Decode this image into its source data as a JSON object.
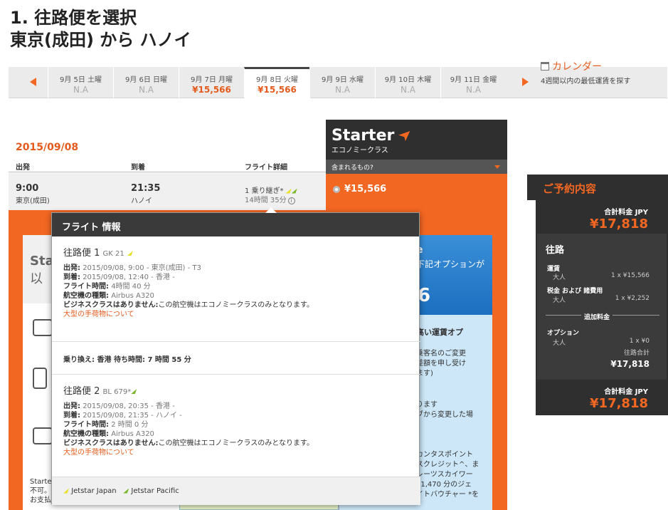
{
  "heading": {
    "line1": "1. 往路便を選択",
    "line2": "東京(成田) から ハノイ"
  },
  "dates": [
    {
      "label": "9月 5日 土曜",
      "price": "N.A",
      "has": false,
      "sel": false
    },
    {
      "label": "9月 6日 日曜",
      "price": "N.A",
      "has": false,
      "sel": false
    },
    {
      "label": "9月 7日 月曜",
      "price": "¥15,566",
      "has": true,
      "sel": false
    },
    {
      "label": "9月 8日 火曜",
      "price": "¥15,566",
      "has": true,
      "sel": true
    },
    {
      "label": "9月 9日 水曜",
      "price": "N.A",
      "has": false,
      "sel": false
    },
    {
      "label": "9月 10日 木曜",
      "price": "N.A",
      "has": false,
      "sel": false
    },
    {
      "label": "9月 11日 金曜",
      "price": "N.A",
      "has": false,
      "sel": false
    }
  ],
  "calendar": {
    "title": "カレンダー",
    "sub": "4週間以内の最低運賃を探す"
  },
  "results": {
    "date": "2015/09/08",
    "col_dep": "出発",
    "col_arr": "到着",
    "col_detail": "フライト詳細",
    "dep_time": "9:00",
    "dep_city": "東京(成田)",
    "arr_time": "21:35",
    "arr_city": "ハノイ",
    "stops": "1 乗り継ぎ*",
    "duration": "14時間 35分"
  },
  "starter": {
    "name": "Starter",
    "sub": "エコノミークラス",
    "bar": "含まれるもの?",
    "price": "¥15,566"
  },
  "leftpanel": {
    "title": "Star",
    "title2": "以",
    "foot1": "Starte",
    "foot2": "不可。",
    "foot3": "お支払いいただきます。搭乗日･時間"
  },
  "bluepanel": {
    "t1": "e",
    "t2": "下記オプションが",
    "big": "6",
    "l1": "高い運賃オプ",
    "l2": "乗客名のご変更",
    "l3": "差額を申し受け",
    "l4": "ます)",
    "l5": "ります",
    "l6": "ブから変更した場",
    "l7": "カンタスポイント",
    "l8": "スクレジット^、ま",
    "l9": "レーツスカイワー",
    "l10": "¥1,470 分のジェ",
    "l11": "イトバウチャー *を"
  },
  "popover": {
    "title": "フライト 情報",
    "seg1": {
      "title": "往路便 1",
      "code": "GK 21",
      "dep_label": "出発:",
      "dep": "2015/09/08, 9:00 - 東京(成田) - T3",
      "arr_label": "到着:",
      "arr": "2015/09/08, 12:40 - 香港 -",
      "dur_label": "フライト時間:",
      "dur": "4時間 40 分",
      "ac_label": "航空機の種類:",
      "ac": "Airbus A320",
      "biz_label": "ビジネスクラスはありません:",
      "biz": "この航空機はエコノミークラスのみとなります。",
      "link": "大型の手荷物について"
    },
    "transfer": "乗り換え: 香港 待ち時間: 7 時間 55 分",
    "seg2": {
      "title": "往路便 2",
      "code": "BL 679*",
      "dep_label": "出発:",
      "dep": "2015/09/08, 20:35 - 香港 -",
      "arr_label": "到着:",
      "arr": "2015/09/08, 21:35 - ハノイ -",
      "dur_label": "フライト時間:",
      "dur": "2 時間 0 分",
      "ac_label": "航空機の種類:",
      "ac": "Airbus A320",
      "biz_label": "ビジネスクラスはありません:",
      "biz": "この航空機はエコノミークラスのみとなります。",
      "link": "大型の手荷物について"
    },
    "legend1": "Jetstar Japan",
    "legend2": "Jetstar Pacific"
  },
  "summary": {
    "tab": "ご予約内容",
    "total_label": "合計料金 JPY",
    "total": "¥17,818",
    "route": "往路",
    "fare_label": "運賃",
    "fare_pax": "大人",
    "fare_val": "1 x ¥15,566",
    "tax_label": "税金 および 諸費用",
    "tax_pax": "大人",
    "tax_val": "1 x ¥2,252",
    "extra_label": "追加料金",
    "opt_label": "オプション",
    "opt_pax": "大人",
    "opt_val": "1 x ¥0",
    "route_total_label": "往路合計",
    "route_total": "¥17,818",
    "total2_label": "合計料金 JPY",
    "total2": "¥17,818"
  }
}
